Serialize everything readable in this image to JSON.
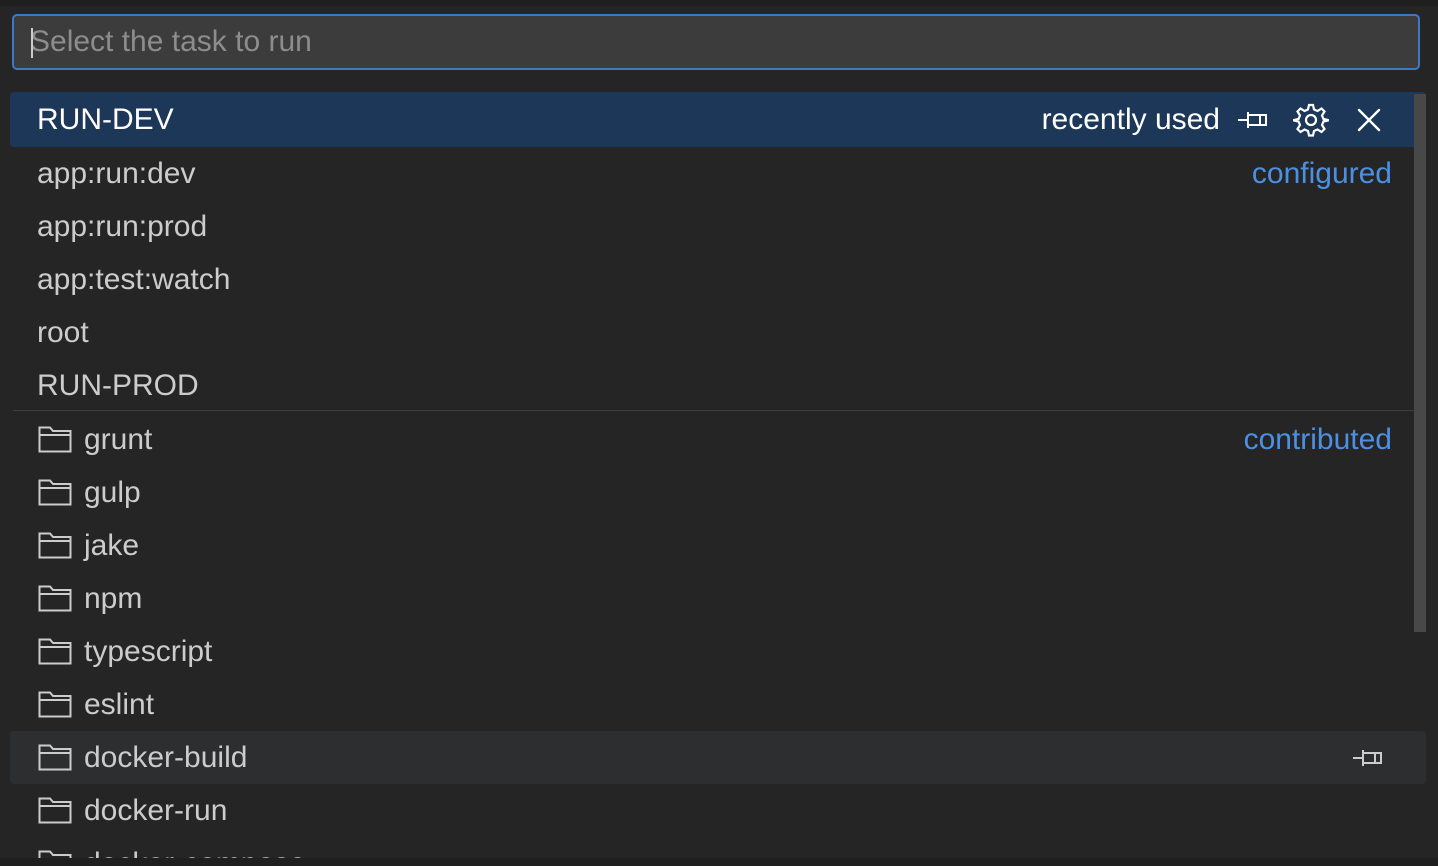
{
  "search": {
    "placeholder": "Select the task to run",
    "value": ""
  },
  "selected": {
    "label": "RUN-DEV",
    "tag": "recently used"
  },
  "configured_tag": "configured",
  "contributed_tag": "contributed",
  "configured_tasks": [
    "app:run:dev",
    "app:run:prod",
    "app:test:watch",
    "root",
    "RUN-PROD"
  ],
  "contributed_groups": [
    "grunt",
    "gulp",
    "jake",
    "npm",
    "typescript",
    "eslint",
    "docker-build",
    "docker-run",
    "docker-compose"
  ],
  "hovered_item": "docker-build",
  "icons": {
    "pin": "pin-icon",
    "gear": "gear-icon",
    "close": "close-icon",
    "folder": "folder-icon"
  },
  "colors": {
    "accent": "#4b90e2",
    "selection": "#1c3758",
    "focus_border": "#3d78c7"
  }
}
